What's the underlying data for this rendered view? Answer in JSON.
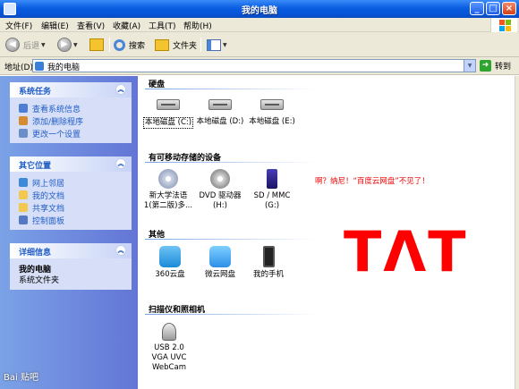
{
  "window": {
    "title": "我的电脑"
  },
  "menu": [
    "文件(F)",
    "编辑(E)",
    "查看(V)",
    "收藏(A)",
    "工具(T)",
    "帮助(H)"
  ],
  "toolbar": {
    "back": "后退",
    "search": "搜索",
    "folders": "文件夹"
  },
  "address": {
    "label": "地址(D)",
    "value": "我的电脑",
    "go": "转到"
  },
  "tasks": [
    {
      "title": "系统任务",
      "links": [
        "查看系统信息",
        "添加/删除程序",
        "更改一个设置"
      ]
    },
    {
      "title": "其它位置",
      "links": [
        "网上邻居",
        "我的文档",
        "共享文档",
        "控制面板"
      ]
    },
    {
      "title": "详细信息",
      "detail_title": "我的电脑",
      "detail_text": "系统文件夹"
    }
  ],
  "groups": {
    "hard_disks": {
      "title": "硬盘",
      "items": [
        "本地磁盘 (C:)",
        "本地磁盘 (D:)",
        "本地磁盘 (E:)"
      ]
    },
    "removable": {
      "title": "有可移动存储的设备",
      "items": [
        "新大学法语1(第二版)多...",
        "DVD 驱动器 (H:)",
        "SD / MMC (G:)"
      ]
    },
    "other": {
      "title": "其他",
      "items": [
        "360云盘",
        "微云网盘",
        "我的手机"
      ]
    },
    "scanners": {
      "title": "扫描仪和照相机",
      "items": [
        "USB 2.0 VGA UVC WebCam"
      ]
    }
  },
  "annotation": {
    "note": "啊？纳尼！“百度云网盘”不见了！",
    "face": "TɅT"
  },
  "watermark": "Bai 贴吧"
}
